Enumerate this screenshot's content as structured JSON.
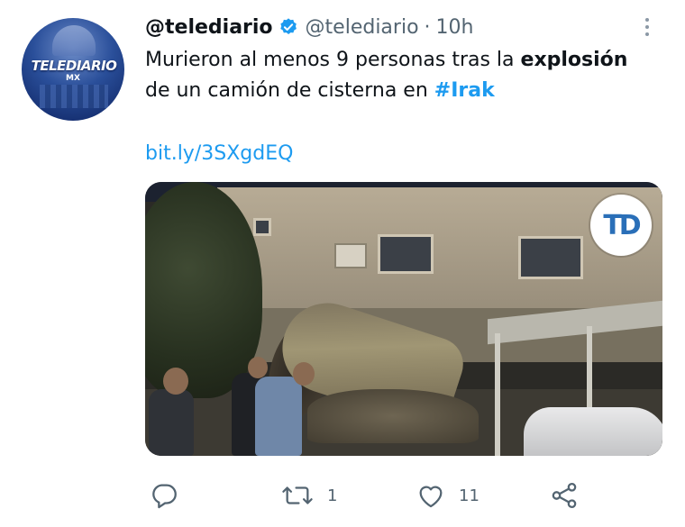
{
  "tweet": {
    "display_name": "@telediario",
    "handle": "@telediario",
    "separator": "·",
    "time": "10h",
    "text_part1": "Murieron al menos 9 personas tras la ",
    "text_bold": "explosión",
    "text_part2": " de un camión de cisterna en ",
    "hashtag": "#Irak",
    "link": "bit.ly/3SXgdEQ"
  },
  "avatar": {
    "logo_text": "TELEDIARIO",
    "sub_text": "MX"
  },
  "media": {
    "watermark": "TD"
  },
  "actions": {
    "reply_count": "",
    "retweet_count": "1",
    "like_count": "11"
  },
  "icons": {
    "verified": "verified-badge-icon",
    "more": "more-options-icon",
    "reply": "reply-icon",
    "retweet": "retweet-icon",
    "like": "heart-icon",
    "share": "share-icon"
  },
  "colors": {
    "accent": "#1d9bf0",
    "muted": "#536471",
    "text": "#0f1419"
  }
}
